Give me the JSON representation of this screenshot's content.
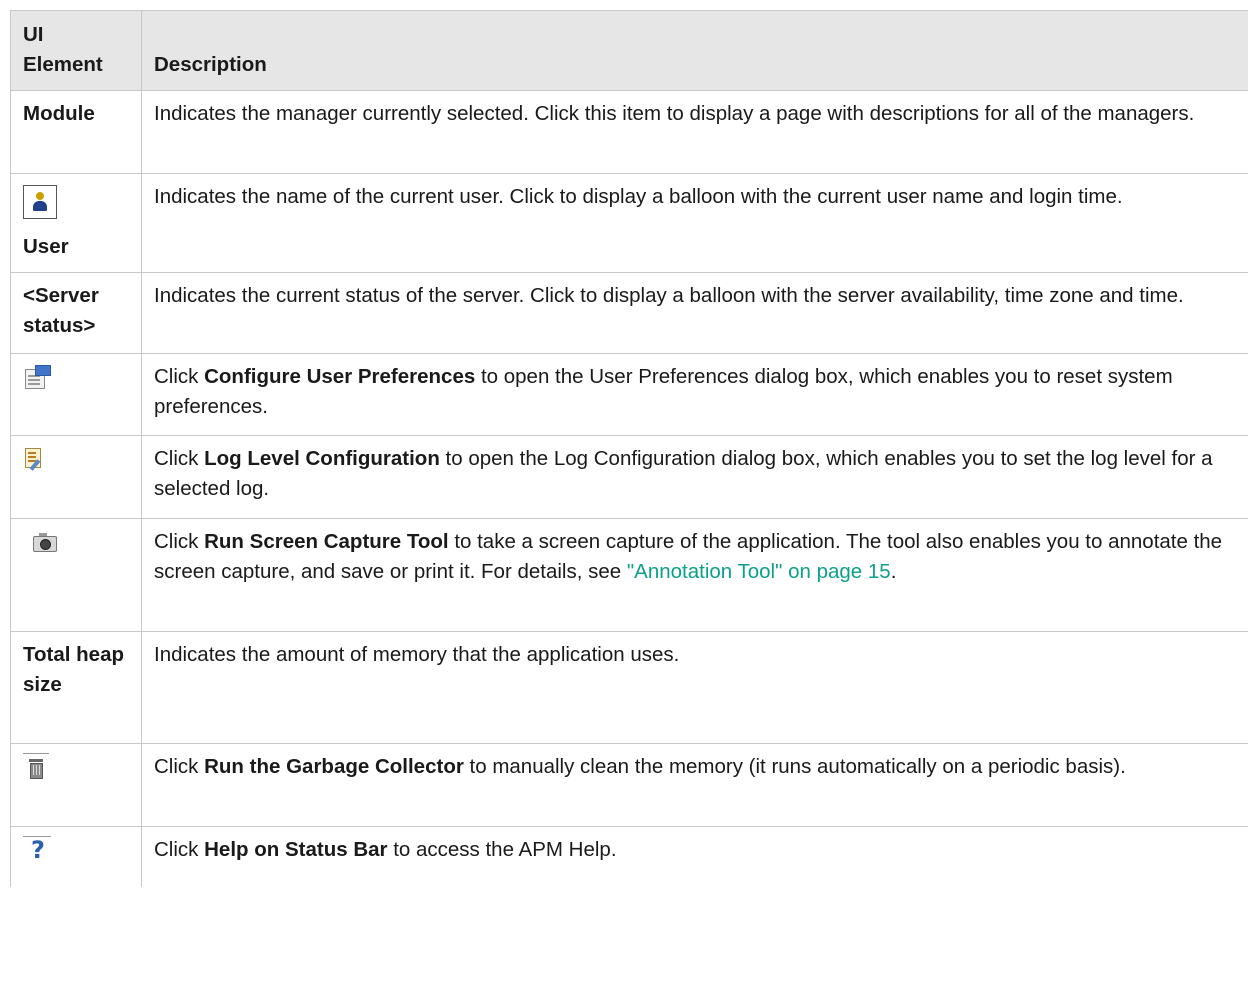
{
  "header": {
    "col1_line1": "UI",
    "col1_line2": "Element",
    "col2": "Description"
  },
  "rows": [
    {
      "element": "Module",
      "text": "Indicates the manager currently selected. Click this item to display a page with descriptions for all of the managers."
    },
    {
      "element_icon": "user-icon",
      "element": "User",
      "text": "Indicates the name of the current user. Click to display a balloon with the current user name and login time."
    },
    {
      "element": "<Server status>",
      "text": "Indicates the current status of the server. Click to display a balloon with the server availability, time zone and time."
    },
    {
      "element_icon": "configure-preferences-icon",
      "pre": "Click ",
      "bold": "Configure User Preferences",
      "post": " to open the User Preferences dialog box, which enables you to reset system preferences."
    },
    {
      "element_icon": "log-configuration-icon",
      "pre": "Click ",
      "bold": "Log Level Configuration",
      "post": " to open the Log Configuration dialog box, which enables you to set the log level for a selected log."
    },
    {
      "element_icon": "camera-icon",
      "pre": "Click ",
      "bold": "Run Screen Capture Tool",
      "post": " to take a screen capture of the application. The tool also enables you to annotate the screen capture, and save or print it. For details, see ",
      "link": "\"Annotation Tool\" on page 15",
      "tail": "."
    },
    {
      "element": "Total heap size",
      "text": "Indicates the amount of memory that the application uses."
    },
    {
      "element_icon": "trash-icon",
      "pre": "Click ",
      "bold": "Run the Garbage Collector",
      "post": " to manually clean the memory (it runs automatically on a periodic basis)."
    },
    {
      "element_icon": "help-icon",
      "pre": "Click ",
      "bold": "Help on Status Bar",
      "post": " to access the APM Help."
    }
  ],
  "colors": {
    "header_bg": "#e6e6e6",
    "border": "#c8c8c8",
    "link": "#0aa288"
  }
}
